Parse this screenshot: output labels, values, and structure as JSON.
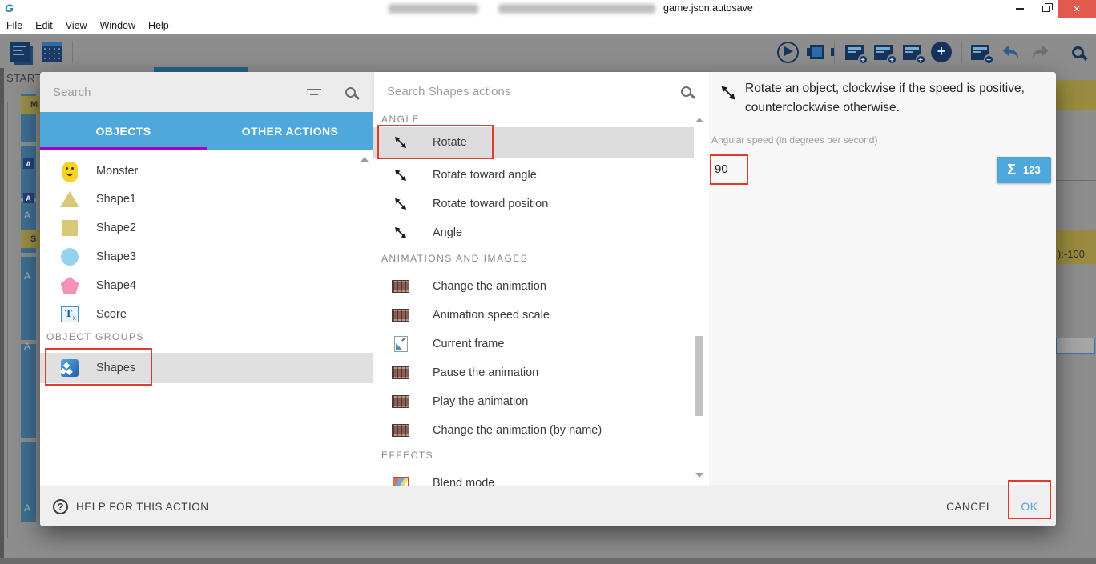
{
  "colors": {
    "accent_blue": "#4FA8DC",
    "tab_underline_purple": "#A400C8",
    "annotation_red": "#E23B2E",
    "close_button_red": "#E25A4E"
  },
  "window": {
    "title": "game.json.autosave",
    "controls": [
      "minimize",
      "restore",
      "close"
    ]
  },
  "menu": {
    "items": [
      "File",
      "Edit",
      "View",
      "Window",
      "Help"
    ]
  },
  "toolbar": {
    "icons": [
      "project-manager",
      "scene-editor",
      "preview-play",
      "debugger",
      "add-event",
      "add-sub-event",
      "add-comment",
      "add-circle",
      "delete-event",
      "undo",
      "redo",
      "search"
    ]
  },
  "background": {
    "scene_tab": "START",
    "letter_m": "M",
    "letter_s": "S",
    "letter_a": "A",
    "right_fragment_text": "):-100"
  },
  "dialog": {
    "object_panel": {
      "search_placeholder": "Search",
      "tabs": [
        {
          "label": "OBJECTS",
          "active": true
        },
        {
          "label": "OTHER ACTIONS",
          "active": false
        }
      ],
      "objects": [
        {
          "label": "Monster"
        },
        {
          "label": "Shape1"
        },
        {
          "label": "Shape2"
        },
        {
          "label": "Shape3"
        },
        {
          "label": "Shape4"
        },
        {
          "label": "Score"
        }
      ],
      "groups_header": "OBJECT GROUPS",
      "groups": [
        {
          "label": "Shapes",
          "selected": true,
          "annotated": true
        }
      ]
    },
    "actions_panel": {
      "search_placeholder": "Search Shapes actions",
      "sections": [
        {
          "header": "ANGLE",
          "items": [
            {
              "label": "Rotate",
              "selected": true,
              "annotated": true
            },
            {
              "label": "Rotate toward angle"
            },
            {
              "label": "Rotate toward position"
            },
            {
              "label": "Angle"
            }
          ]
        },
        {
          "header": "ANIMATIONS AND IMAGES",
          "items": [
            {
              "label": "Change the animation"
            },
            {
              "label": "Animation speed scale"
            },
            {
              "label": "Current frame"
            },
            {
              "label": "Pause the animation"
            },
            {
              "label": "Play the animation"
            },
            {
              "label": "Change the animation (by name)"
            }
          ]
        },
        {
          "header": "EFFECTS",
          "items": [
            {
              "label": "Blend mode"
            }
          ]
        }
      ]
    },
    "detail_panel": {
      "description": "Rotate an object, clockwise if the speed is positive, counterclockwise otherwise.",
      "field_label": "Angular speed (in degrees per second)",
      "field_value": "90",
      "expression_button": {
        "sigma": "Σ",
        "digits": "123"
      }
    },
    "footer": {
      "help": "HELP FOR THIS ACTION",
      "cancel": "CANCEL",
      "ok": "OK"
    }
  }
}
